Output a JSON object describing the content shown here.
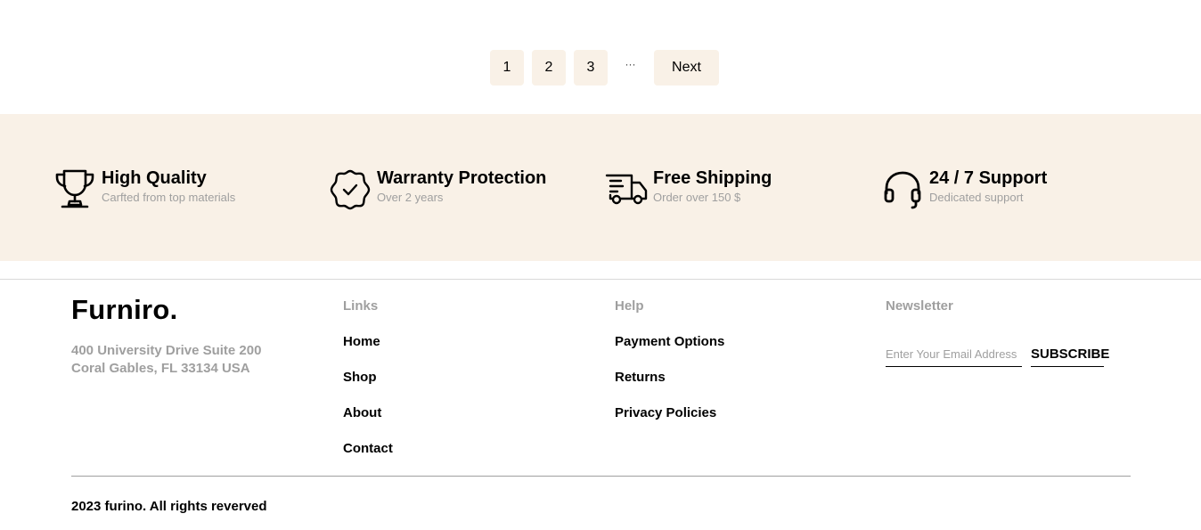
{
  "pagination": {
    "pages": [
      "1",
      "2",
      "3"
    ],
    "ellipsis": "···",
    "next_label": "Next"
  },
  "features": [
    {
      "icon": "trophy-icon",
      "title": "High Quality",
      "subtitle": "Carfted from top materials"
    },
    {
      "icon": "guarantee-icon",
      "title": "Warranty Protection",
      "subtitle": "Over 2 years"
    },
    {
      "icon": "shipping-icon",
      "title": "Free Shipping",
      "subtitle": "Order over 150 $"
    },
    {
      "icon": "customer-support-icon",
      "title": "24 / 7 Support",
      "subtitle": "Dedicated support"
    }
  ],
  "footer": {
    "brand": "Furniro.",
    "address": "400 University Drive Suite 200 Coral Gables, FL 33134 USA",
    "links": {
      "heading": "Links",
      "items": [
        "Home",
        "Shop",
        "About",
        "Contact"
      ]
    },
    "help": {
      "heading": "Help",
      "items": [
        "Payment Options",
        "Returns",
        "Privacy Policies"
      ]
    },
    "newsletter": {
      "heading": "Newsletter",
      "placeholder": "Enter Your Email Address",
      "value": "",
      "button_label": "SUBSCRIBE"
    },
    "copyright": "2023 furino. All rights reverved"
  },
  "colors": {
    "band_background": "#F9F1E7",
    "muted_text": "#9F9F9F",
    "text": "#000000"
  }
}
